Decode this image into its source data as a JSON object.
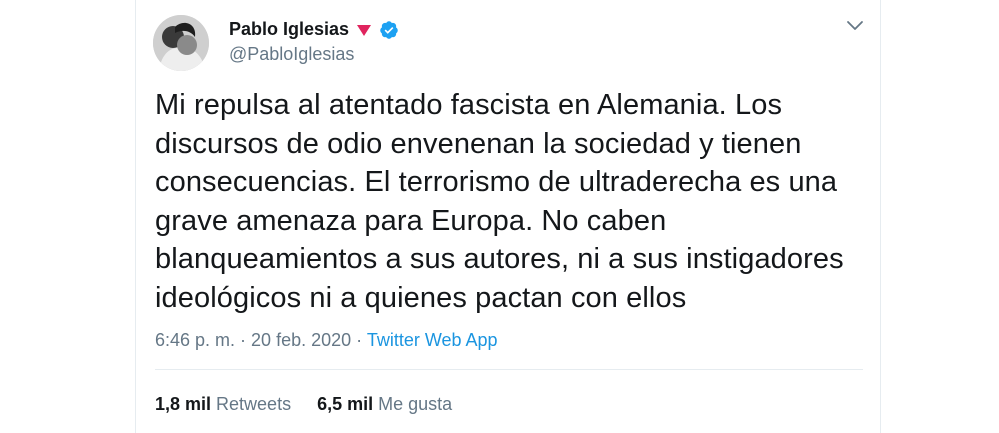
{
  "tweet": {
    "author_name": "Pablo Iglesias",
    "author_handle": "@PabloIglesias",
    "text_lines": [
      "Mi repulsa al atentado fascista en Alemania. Los",
      "discursos de odio envenenan la sociedad y tienen",
      "consecuencias. El terrorismo de ultraderecha es una",
      "grave amenaza para Europa. No caben",
      "blanqueamientos a sus autores, ni a sus instigadores",
      "ideológicos ni a quienes pactan con ellos"
    ],
    "time": "6:46 p. m.",
    "separator": " · ",
    "date": "20 feb. 2020",
    "app": "Twitter Web App",
    "retweets_count": "1,8 mil",
    "retweets_label": "Retweets",
    "likes_count": "6,5 mil",
    "likes_label": "Me gusta"
  },
  "icons": {
    "badge": "rose-icon",
    "verified": "verified-badge-icon",
    "menu": "chevron-down-icon"
  },
  "colors": {
    "link": "#1b95e0",
    "badge": "#e0245e",
    "verified": "#1da1f2",
    "text": "#14171a",
    "muted": "#657786"
  }
}
